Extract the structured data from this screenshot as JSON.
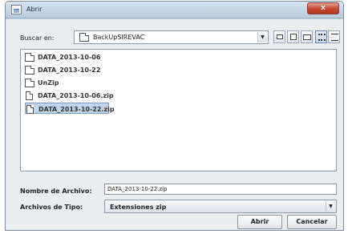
{
  "window": {
    "title": "Abrir",
    "close_glyph": "x"
  },
  "look_in": {
    "label": "Buscar en:",
    "value": "BackUpSIREVAC",
    "toolbar_icons": [
      "up-folder-icon",
      "home-icon",
      "new-folder-icon",
      "list-view-icon",
      "details-view-icon"
    ]
  },
  "files": [
    {
      "name": "DATA_2013-10-06",
      "type": "folder",
      "selected": false
    },
    {
      "name": "DATA_2013-10-22",
      "type": "folder",
      "selected": false
    },
    {
      "name": "UnZip",
      "type": "folder",
      "selected": false
    },
    {
      "name": "DATA_2013-10-06.zip",
      "type": "file",
      "selected": false
    },
    {
      "name": "DATA_2013-10-22.zip",
      "type": "file",
      "selected": true
    }
  ],
  "file_name": {
    "label": "Nombre de Archivo:",
    "value": "DATA_2013-10-22.zip"
  },
  "file_type": {
    "label": "Archivos de Tipo:",
    "value": "Extensiones zip"
  },
  "buttons": {
    "open": "Abrir",
    "cancel": "Cancelar"
  },
  "colors": {
    "selection": "#c3d5ec",
    "close_button": "#c4432c",
    "titlebar": "#b9cbde"
  }
}
